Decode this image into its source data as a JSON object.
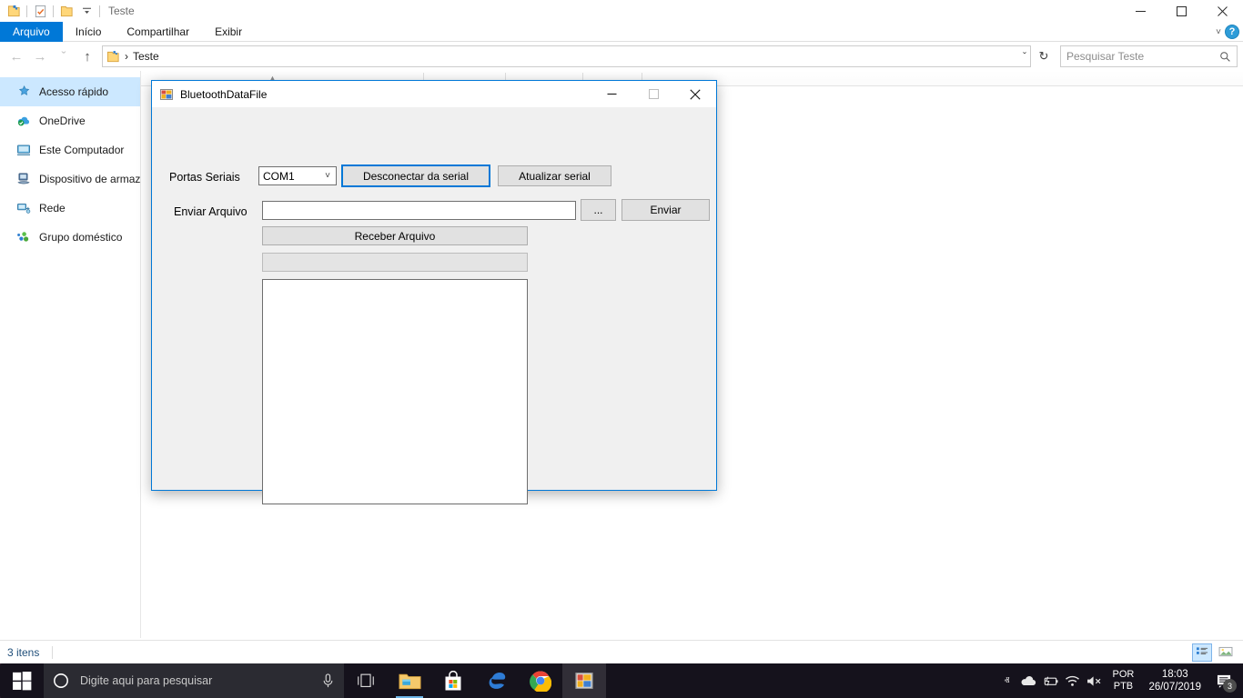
{
  "explorer": {
    "window_title": "Teste",
    "quick_access_icons": [
      "folder-new-icon",
      "properties-icon",
      "folder-icon",
      "dropdown-customize-icon"
    ],
    "caption_buttons": [
      {
        "name": "minimize-button",
        "glyph": "—"
      },
      {
        "name": "maximize-button",
        "glyph": "☐"
      },
      {
        "name": "close-button",
        "glyph": "✕"
      }
    ],
    "ribbon_tabs": [
      {
        "label": "Arquivo",
        "active": true
      },
      {
        "label": "Início",
        "active": false
      },
      {
        "label": "Compartilhar",
        "active": false
      },
      {
        "label": "Exibir",
        "active": false
      }
    ],
    "ribbon_help_label": "?",
    "nav": {
      "back_label": "←",
      "forward_label": "→",
      "history_label": "ˇ",
      "up_label": "↑"
    },
    "address": {
      "path_label": "Teste",
      "separator": "›",
      "dropdown_label": "ˇ",
      "refresh_label": "↻"
    },
    "search": {
      "placeholder": "Pesquisar Teste",
      "icon": "search-icon"
    },
    "sidebar": [
      {
        "label": "Acesso rápido",
        "icon": "pin-star-icon",
        "selected": true
      },
      {
        "label": "OneDrive",
        "icon": "onedrive-cloud-icon",
        "selected": false
      },
      {
        "label": "Este Computador",
        "icon": "this-pc-monitor-icon",
        "selected": false
      },
      {
        "label": "Dispositivo de armaz",
        "icon": "storage-device-icon",
        "selected": false
      },
      {
        "label": "Rede",
        "icon": "network-icon",
        "selected": false
      },
      {
        "label": "Grupo doméstico",
        "icon": "homegroup-icon",
        "selected": false
      }
    ],
    "status": {
      "item_count": "3 itens",
      "view_buttons": [
        {
          "name": "details-view-button",
          "selected": true
        },
        {
          "name": "large-icons-view-button",
          "selected": false
        }
      ]
    }
  },
  "dialog": {
    "title": "BluetoothDataFile",
    "icon": "winforms-app-icon",
    "caption_buttons": [
      {
        "name": "dialog-minimize-button",
        "glyph": "—"
      },
      {
        "name": "dialog-maximize-button",
        "glyph": "☐"
      },
      {
        "name": "dialog-close-button",
        "glyph": "✕"
      }
    ],
    "serial_label": "Portas Seriais",
    "serial_port_value": "COM1",
    "serial_port_options": [
      "COM1"
    ],
    "disconnect_button": "Desconectar da serial",
    "refresh_serial_button": "Atualizar serial",
    "send_file_label": "Enviar Arquivo",
    "file_path_value": "",
    "browse_button": "...",
    "send_button": "Enviar",
    "receive_button": "Receber Arquivo",
    "progress_label": "",
    "log_value": ""
  },
  "taskbar": {
    "start_label": "start-icon",
    "cortana_placeholder": "Digite aqui para pesquisar",
    "mic_icon": "microphone-icon",
    "taskview_icon": "task-view-icon",
    "apps": [
      {
        "name": "taskbar-file-explorer",
        "icon": "folder-icon",
        "running": true,
        "active": false
      },
      {
        "name": "taskbar-microsoft-store",
        "icon": "store-bag-icon",
        "running": false,
        "active": false
      },
      {
        "name": "taskbar-edge",
        "icon": "edge-icon",
        "running": false,
        "active": false
      },
      {
        "name": "taskbar-chrome",
        "icon": "chrome-icon",
        "running": true,
        "active": false
      },
      {
        "name": "taskbar-bluetoothdatafile",
        "icon": "winforms-app-icon",
        "running": true,
        "active": true
      }
    ],
    "tray": {
      "show_hidden_label": "ⱏ",
      "onedrive_icon": "cloud-icon",
      "battery_icon": "battery-icon",
      "wifi_icon": "wifi-icon",
      "volume_icon": "volume-muted-icon",
      "language_line1": "POR",
      "language_line2": "PTB",
      "time": "18:03",
      "date": "26/07/2019",
      "notification_count": "3"
    }
  },
  "colors": {
    "accent": "#0078d7",
    "tab_active_bg": "#0078d7",
    "sidebar_selection": "#cce8ff",
    "dialog_face": "#f0f0f0",
    "taskbar_bg": "#15121c"
  }
}
